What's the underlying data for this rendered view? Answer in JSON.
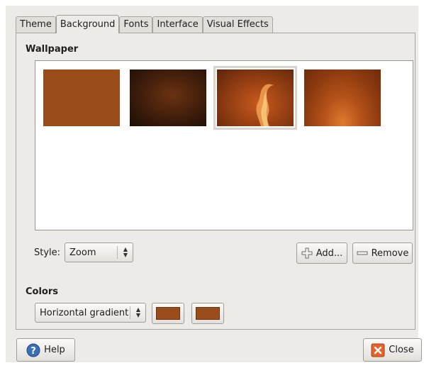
{
  "tabs": [
    "Theme",
    "Background",
    "Fonts",
    "Interface",
    "Visual Effects"
  ],
  "active_tab": "Background",
  "wallpaper": {
    "section_title": "Wallpaper",
    "thumbnails": [
      {
        "name": "plain-brown",
        "colors": [
          "#9a4c1a"
        ]
      },
      {
        "name": "dark-texture",
        "colors": [
          "#6b3212",
          "#1c0d05"
        ]
      },
      {
        "name": "flame-swirl",
        "colors": [
          "#c85a1e",
          "#5c2509"
        ],
        "selected": true
      },
      {
        "name": "glow-gradient",
        "colors": [
          "#e07a2e",
          "#6f2c0a"
        ]
      }
    ],
    "style_label": "Style:",
    "style_value": "Zoom",
    "add_label": "Add...",
    "remove_label": "Remove"
  },
  "colors": {
    "section_title": "Colors",
    "gradient_value": "Horizontal gradient",
    "primary_color": "#9a4c1a",
    "secondary_color": "#9a4c1a"
  },
  "footer": {
    "help_label": "Help",
    "close_label": "Close"
  },
  "icon_names": [
    "help-icon",
    "close-icon",
    "add-icon",
    "remove-icon",
    "combo-arrows-icon"
  ]
}
